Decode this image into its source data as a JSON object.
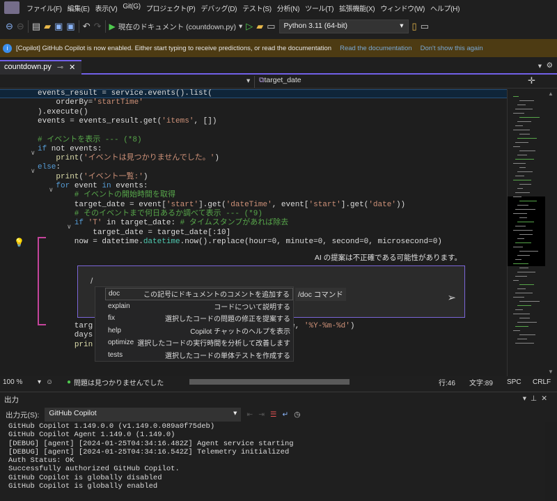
{
  "menu": [
    "ファイル(F)",
    "編集(E)",
    "表示(V)",
    "Git(G)",
    "プロジェクト(P)",
    "デバッグ(D)",
    "テスト(S)",
    "分析(N)",
    "ツール(T)",
    "拡張機能(X)",
    "ウィンドウ(W)",
    "ヘルプ(H)"
  ],
  "toolbar": {
    "run_label": "現在のドキュメント (countdown.py)",
    "python_env": "Python 3.11 (64-bit)"
  },
  "infobar": {
    "message": "[Copilot] GitHub Copilot is now enabled. Either start typing to receive predictions, or read the documentation",
    "link1": "Read the documentation",
    "link2": "Don't show this again"
  },
  "tab": {
    "label": "countdown.py",
    "pin": "⊸",
    "close": "✕"
  },
  "navbar": {
    "member": "target_date"
  },
  "code_lines": [
    [
      [
        "events_result = service.events().list(",
        "tx"
      ]
    ],
    [
      [
        "    orderBy=",
        "tx"
      ],
      [
        "'startTime'",
        "st"
      ]
    ],
    [
      [
        ").execute()",
        "tx"
      ]
    ],
    [
      [
        "events = events_result.get(",
        "tx"
      ],
      [
        "'items'",
        "st"
      ],
      [
        ", [])",
        "tx"
      ]
    ],
    [],
    [
      [
        "# イベントを表示 --- (*8)",
        "cm"
      ]
    ],
    [
      [
        "if",
        "kw"
      ],
      [
        " not events:",
        "tx"
      ]
    ],
    [
      [
        "    ",
        "tx"
      ],
      [
        "print",
        "fn"
      ],
      [
        "(",
        "tx"
      ],
      [
        "'イベントは見つかりませんでした。'",
        "st"
      ],
      [
        ")",
        "tx"
      ]
    ],
    [
      [
        "else",
        "kw"
      ],
      [
        ":",
        "tx"
      ]
    ],
    [
      [
        "    ",
        "tx"
      ],
      [
        "print",
        "fn"
      ],
      [
        "(",
        "tx"
      ],
      [
        "'イベント一覧:'",
        "st"
      ],
      [
        ")",
        "tx"
      ]
    ],
    [
      [
        "    ",
        "tx"
      ],
      [
        "for",
        "kw"
      ],
      [
        " event ",
        "tx"
      ],
      [
        "in",
        "kw"
      ],
      [
        " events:",
        "tx"
      ]
    ],
    [
      [
        "        # イベントの開始時間を取得",
        "cm"
      ]
    ],
    [
      [
        "        target_date = event[",
        "tx"
      ],
      [
        "'start'",
        "st"
      ],
      [
        "].get(",
        "tx"
      ],
      [
        "'dateTime'",
        "st"
      ],
      [
        ", event[",
        "tx"
      ],
      [
        "'start'",
        "st"
      ],
      [
        "].get(",
        "tx"
      ],
      [
        "'date'",
        "st"
      ],
      [
        "))",
        "tx"
      ]
    ],
    [
      [
        "        # そのイベントまで何日あるか調べて表示 --- (*9)",
        "cm"
      ]
    ],
    [
      [
        "        ",
        "tx"
      ],
      [
        "if",
        "kw"
      ],
      [
        " ",
        "tx"
      ],
      [
        "'T'",
        "st"
      ],
      [
        " in target_date: ",
        "tx"
      ],
      [
        "# タイムスタンプがあれば除去",
        "cm"
      ]
    ],
    [
      [
        "            target_date = target_date[:10]",
        "tx"
      ]
    ],
    [
      [
        "        now = datetime.",
        "tx"
      ],
      [
        "datetime",
        "cl"
      ],
      [
        ".now().replace(hour=0, minute=0, second=0, microsecond=0)",
        "tx"
      ]
    ]
  ],
  "code_after": [
    [
      [
        "        targ",
        "tx"
      ],
      [
        "                                          te, ",
        "tx"
      ],
      [
        "'%Y-%m-%d'",
        "st"
      ],
      [
        ")",
        "tx"
      ]
    ],
    [
      [
        "        days",
        "tx"
      ]
    ],
    [
      [
        "        ",
        "tx"
      ],
      [
        "prin",
        "fn"
      ]
    ]
  ],
  "chat": {
    "ai_warning": "AI の提案は不正確である可能性があります。",
    "input": "/",
    "hint": "/doc コマンド",
    "commands": [
      {
        "name": "doc",
        "desc": "この記号にドキュメントのコメントを追加する"
      },
      {
        "name": "explain",
        "desc": "コードについて説明する"
      },
      {
        "name": "fix",
        "desc": "選択したコードの問題の修正を提案する"
      },
      {
        "name": "help",
        "desc": "Copilot チャットのヘルプを表示"
      },
      {
        "name": "optimize",
        "desc": "選択したコードの実行時間を分析して改善します"
      },
      {
        "name": "tests",
        "desc": "選択したコードの単体テストを作成する"
      }
    ]
  },
  "status": {
    "zoom": "100 %",
    "issues": "問題は見つかりませんでした",
    "line": "行:46",
    "char": "文字:89",
    "spc": "SPC",
    "crlf": "CRLF"
  },
  "output": {
    "title": "出力",
    "source_label": "出力元(S):",
    "source": "GitHub Copilot",
    "lines": [
      "GitHub Copilot 1.149.0.0 (v1.149.0.089a0f75deb)",
      "GitHub Copilot Agent 1.149.0 (1.149.0)",
      "[DEBUG] [agent] [2024-01-25T04:34:16.482Z] Agent service starting",
      "[DEBUG] [agent] [2024-01-25T04:34:16.542Z] Telemetry initialized",
      "Auth Status: OK",
      "Successfully authorized GitHub Copilot.",
      "GitHub Copilot is globally disabled",
      "GitHub Copilot is globally enabled"
    ]
  },
  "colors": {
    "accent": "#7160e8",
    "infobar": "#4d3b13",
    "bracket": "#c5449c"
  }
}
